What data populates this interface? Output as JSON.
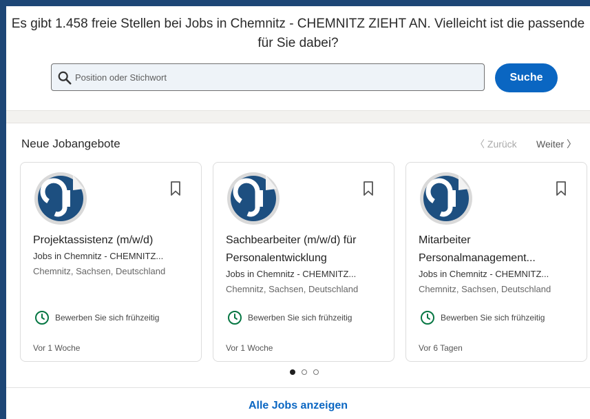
{
  "header": {
    "headline": "Es gibt 1.458 freie Stellen bei Jobs in Chemnitz - CHEMNITZ ZIEHT AN. Vielleicht ist die passende für Sie dabei?"
  },
  "search": {
    "placeholder": "Position oder Stichwort",
    "value": "",
    "button_label": "Suche",
    "icon": "search-icon"
  },
  "section": {
    "title": "Neue Jobangebote",
    "prev_label": "〈 Zurück",
    "next_label": "Weiter 〉"
  },
  "cards": [
    {
      "title": "Projektassistenz (m/w/d)",
      "company": "Jobs in Chemnitz - CHEMNITZ...",
      "location": "Chemnitz, Sachsen, Deutschland",
      "apply_hint": "Bewerben Sie sich frühzeitig",
      "posted": "Vor 1 Woche"
    },
    {
      "title": "Sachbearbeiter (m/w/d) für Personalentwicklung",
      "company": "Jobs in Chemnitz - CHEMNITZ...",
      "location": "Chemnitz, Sachsen, Deutschland",
      "apply_hint": "Bewerben Sie sich frühzeitig",
      "posted": "Vor 1 Woche"
    },
    {
      "title": "Mitarbeiter Personalmanagement...",
      "company": "Jobs in Chemnitz - CHEMNITZ...",
      "location": "Chemnitz, Sachsen, Deutschland",
      "apply_hint": "Bewerben Sie sich frühzeitig",
      "posted": "Vor 6 Tagen"
    }
  ],
  "pagination": {
    "pages": 3,
    "active": 1
  },
  "footer": {
    "all_jobs_label": "Alle Jobs anzeigen"
  },
  "colors": {
    "accent": "#0a66c2",
    "logo_blue": "#1d4f80",
    "clock_green": "#057642",
    "frame": "#1d4676"
  }
}
